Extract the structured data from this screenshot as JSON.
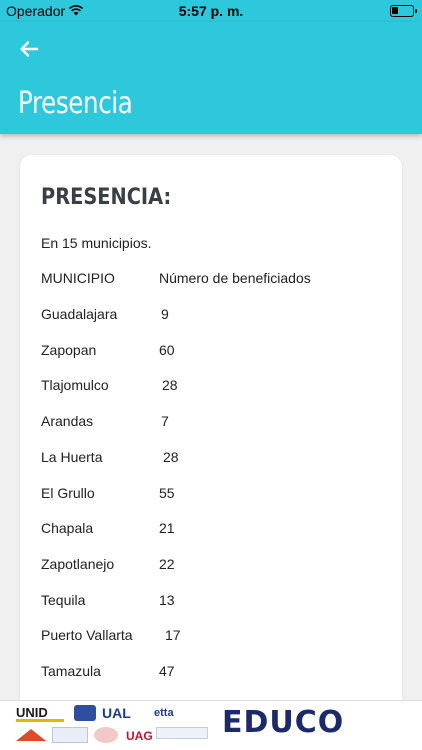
{
  "status_bar": {
    "carrier": "Operador",
    "time": "5:57 p. m."
  },
  "header": {
    "title": "Presencia"
  },
  "card": {
    "heading": "PRESENCIA:",
    "intro": "En 15 municipios.",
    "columns": [
      "MUNICIPIO",
      "Número de beneficiados"
    ],
    "rows": [
      {
        "municipio": "Guadalajara",
        "beneficiados": "9"
      },
      {
        "municipio": "Zapopan",
        "beneficiados": "60"
      },
      {
        "municipio": "Tlajomulco",
        "beneficiados": "28"
      },
      {
        "municipio": "Arandas",
        "beneficiados": "7"
      },
      {
        "municipio": "La Huerta",
        "beneficiados": "28"
      },
      {
        "municipio": "El Grullo",
        "beneficiados": "55"
      },
      {
        "municipio": "Chapala",
        "beneficiados": "21"
      },
      {
        "municipio": "Zapotlanejo",
        "beneficiados": "22"
      },
      {
        "municipio": "Tequila",
        "beneficiados": "13"
      },
      {
        "municipio": "Puerto Vallarta",
        "beneficiados": "17"
      },
      {
        "municipio": "Tamazula",
        "beneficiados": "47"
      }
    ]
  },
  "footer": {
    "logo_left": "UNID",
    "logo_ual": "UAL",
    "logo_etta": "etta",
    "logo_uag": "UAG",
    "logo_right": "EDUCO"
  },
  "colors": {
    "accent": "#2ec8dc",
    "brand_dark": "#1b2a6b",
    "heading": "#3a3e45"
  }
}
